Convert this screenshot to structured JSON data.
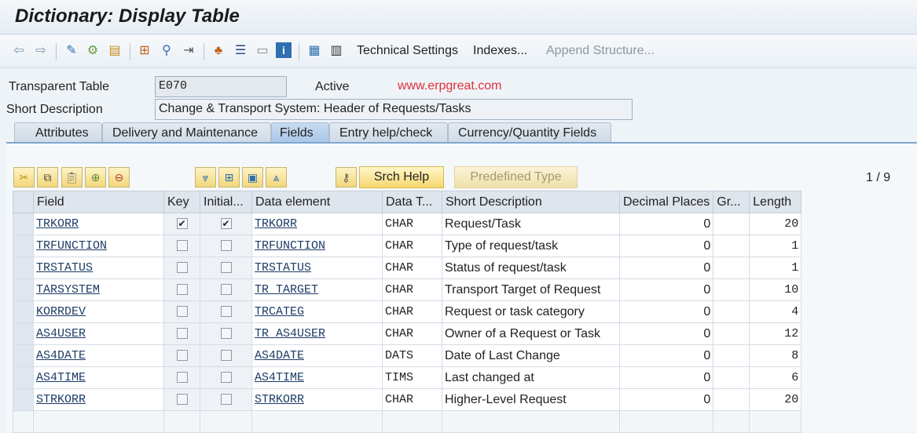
{
  "window": {
    "title": "Dictionary: Display Table"
  },
  "toolbar": {
    "technical_settings": "Technical Settings",
    "indexes": "Indexes...",
    "append_structure": "Append Structure..."
  },
  "header": {
    "table_label": "Transparent Table",
    "table_value": "E070",
    "status": "Active",
    "watermark": "www.erpgreat.com",
    "short_desc_label": "Short Description",
    "short_desc_value": "Change & Transport System: Header of Requests/Tasks"
  },
  "tabs": [
    {
      "label": "Attributes",
      "active": false
    },
    {
      "label": "Delivery and Maintenance",
      "active": false
    },
    {
      "label": "Fields",
      "active": true
    },
    {
      "label": "Entry help/check",
      "active": false
    },
    {
      "label": "Currency/Quantity Fields",
      "active": false
    }
  ],
  "fields_toolbar": {
    "srch_help": "Srch Help",
    "predefined_type": "Predefined Type",
    "page_indicator": "1 / 9"
  },
  "grid": {
    "columns": [
      "Field",
      "Key",
      "Initial...",
      "Data element",
      "Data T...",
      "Short Description",
      "Decimal Places",
      "Gr...",
      "Length"
    ],
    "rows": [
      {
        "field": "TRKORR",
        "key": true,
        "initial": true,
        "data_element": "TRKORR",
        "data_type": "CHAR",
        "short_description": "Request/Task",
        "decimal_places": "0",
        "group": "",
        "length": "20"
      },
      {
        "field": "TRFUNCTION",
        "key": false,
        "initial": false,
        "data_element": "TRFUNCTION",
        "data_type": "CHAR",
        "short_description": "Type of request/task",
        "decimal_places": "0",
        "group": "",
        "length": "1"
      },
      {
        "field": "TRSTATUS",
        "key": false,
        "initial": false,
        "data_element": "TRSTATUS",
        "data_type": "CHAR",
        "short_description": "Status of request/task",
        "decimal_places": "0",
        "group": "",
        "length": "1"
      },
      {
        "field": "TARSYSTEM",
        "key": false,
        "initial": false,
        "data_element": "TR_TARGET",
        "data_type": "CHAR",
        "short_description": "Transport Target of Request",
        "decimal_places": "0",
        "group": "",
        "length": "10"
      },
      {
        "field": "KORRDEV",
        "key": false,
        "initial": false,
        "data_element": "TRCATEG",
        "data_type": "CHAR",
        "short_description": "Request or task category",
        "decimal_places": "0",
        "group": "",
        "length": "4"
      },
      {
        "field": "AS4USER",
        "key": false,
        "initial": false,
        "data_element": "TR_AS4USER",
        "data_type": "CHAR",
        "short_description": "Owner of a Request or Task",
        "decimal_places": "0",
        "group": "",
        "length": "12"
      },
      {
        "field": "AS4DATE",
        "key": false,
        "initial": false,
        "data_element": "AS4DATE",
        "data_type": "DATS",
        "short_description": "Date of Last Change",
        "decimal_places": "0",
        "group": "",
        "length": "8"
      },
      {
        "field": "AS4TIME",
        "key": false,
        "initial": false,
        "data_element": "AS4TIME",
        "data_type": "TIMS",
        "short_description": "Last changed at",
        "decimal_places": "0",
        "group": "",
        "length": "6"
      },
      {
        "field": "STRKORR",
        "key": false,
        "initial": false,
        "data_element": "STRKORR",
        "data_type": "CHAR",
        "short_description": "Higher-Level Request",
        "decimal_places": "0",
        "group": "",
        "length": "20"
      }
    ]
  },
  "icons": {
    "toolbar": [
      "back-arrow-icon",
      "forward-arrow-icon",
      "display-change-icon",
      "active-inactive-icon",
      "other-object-icon",
      "hierarchy-icon",
      "where-used-icon",
      "transfer-icon",
      "object-tree-icon",
      "align-icon",
      "screen-icon",
      "info-icon",
      "layout-icon",
      "table-icon"
    ],
    "grid_toolbar": [
      "cut-icon",
      "copy-icon",
      "paste-icon",
      "insert-row-icon",
      "delete-row-icon",
      "filter-down-icon",
      "insert-icon",
      "clipboard-icon",
      "filter-up-icon",
      "key-icon"
    ]
  },
  "colors": {
    "accent": "#a9c7e8",
    "watermark": "#e0303a",
    "button": "#f5d86e"
  }
}
